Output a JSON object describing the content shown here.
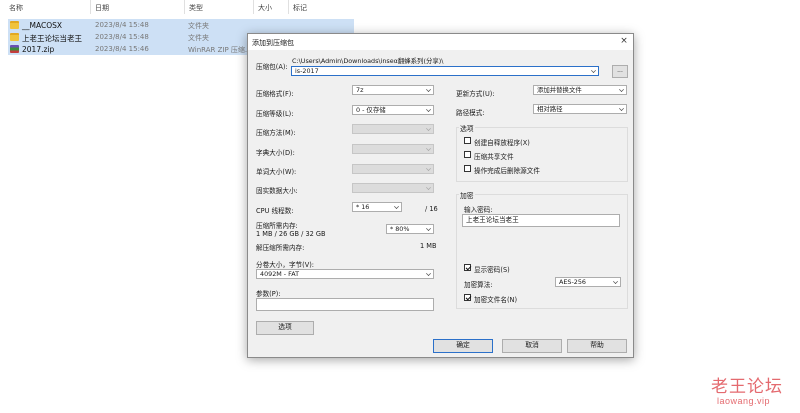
{
  "explorer": {
    "columns": [
      "名称",
      "日期",
      "类型",
      "大小",
      "标记"
    ],
    "files": [
      {
        "name": "__MACOSX",
        "date": "2023/8/4 15:48",
        "type": "文件夹",
        "icon": "folder-icon"
      },
      {
        "name": "上老王论坛当老王",
        "date": "2023/8/4 15:48",
        "type": "文件夹",
        "icon": "folder-icon"
      },
      {
        "name": "2017.zip",
        "date": "2023/8/4 15:46",
        "type": "WinRAR ZIP 压缩...",
        "icon": "winrar-icon"
      }
    ]
  },
  "dialog": {
    "title": "添加到压缩包",
    "close": "×",
    "archive_label": "压缩包(A):",
    "archive_path": "C:\\Users\\Admin\\Downloads\\inseα翻蜂系列(分享)\\",
    "archive_name": "is-2017",
    "browse": "...",
    "format_label": "压缩格式(F):",
    "format_value": "7z",
    "level_label": "压缩等级(L):",
    "level_value": "0 - 仅存储",
    "method_label": "压缩方法(M):",
    "dict_label": "字典大小(D):",
    "word_label": "单词大小(W):",
    "solid_label": "固实数据大小:",
    "threads_label": "CPU 线程数:",
    "threads_value": "* 16",
    "threads_total": "/ 16",
    "mem_label": "压缩所需内存:",
    "mem_value": "1 MB / 26 GB / 32 GB",
    "mem_percent": "* 80%",
    "decomp_label": "解压缩所需内存:",
    "decomp_value": "1 MB",
    "split_label": "分卷大小，字节(V):",
    "split_value": "4092M - FAT",
    "params_label": "参数(P):",
    "params_value": "",
    "options_button": "选项",
    "update_label": "更新方式(U):",
    "update_value": "添加并替换文件",
    "path_label": "路径模式:",
    "path_value": "相对路径",
    "options_group": "选项",
    "options": [
      {
        "label": "创建自释放程序(X)",
        "checked": false
      },
      {
        "label": "压缩共享文件",
        "checked": false
      },
      {
        "label": "操作完成后删除源文件",
        "checked": false
      }
    ],
    "encrypt_group": "加密",
    "password_label": "输入密码:",
    "password_value": "上老王论坛当老王",
    "show_password": "显示密码(S)",
    "show_password_checked": true,
    "enc_method_label": "加密算法:",
    "enc_method_value": "AES-256",
    "encrypt_names": "加密文件名(N)",
    "encrypt_names_checked": true,
    "ok": "确定",
    "cancel": "取消",
    "help": "帮助"
  },
  "watermark": {
    "main": "老王论坛",
    "sub": "laowang.vip"
  }
}
